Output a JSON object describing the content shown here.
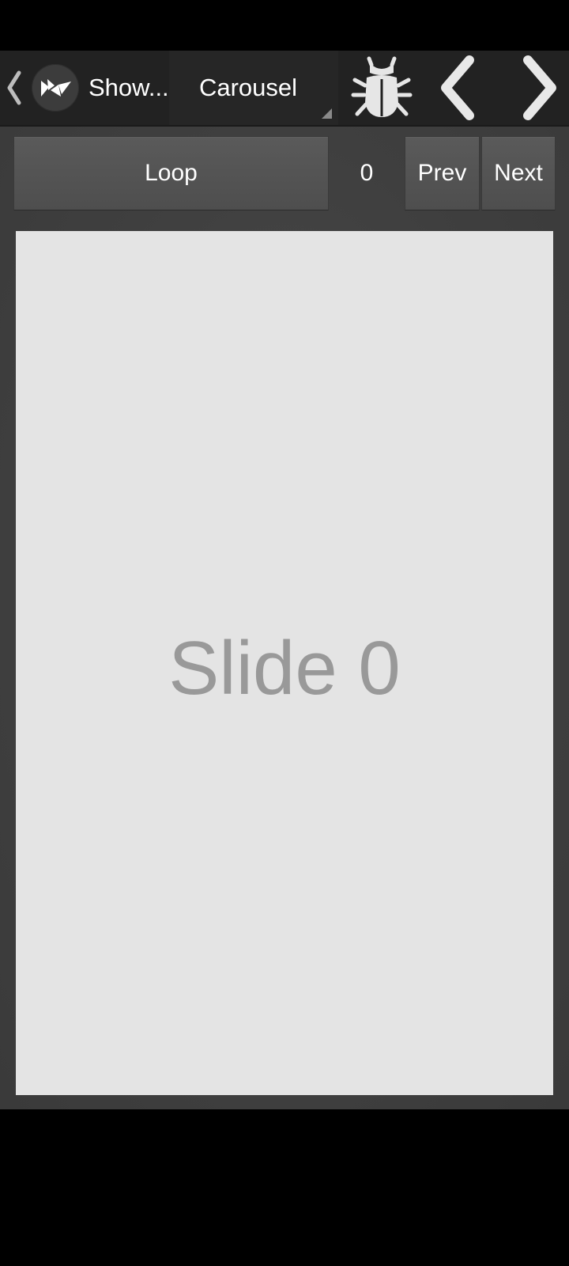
{
  "action_bar": {
    "app_title": "Show...",
    "selected_page": "Carousel",
    "icons": [
      "chevron-left-icon",
      "kivy-logo-icon",
      "bug-icon",
      "prev-arrow-icon",
      "next-arrow-icon"
    ]
  },
  "toolbar": {
    "loop_label": "Loop",
    "index": "0",
    "prev_label": "Prev",
    "next_label": "Next"
  },
  "carousel": {
    "slide_label": "Slide 0"
  },
  "colors": {
    "action_bar": "#222222",
    "background": "#3f3f3f",
    "button": "#555555",
    "slide": "#e4e4e4",
    "slide_text": "#999999"
  }
}
